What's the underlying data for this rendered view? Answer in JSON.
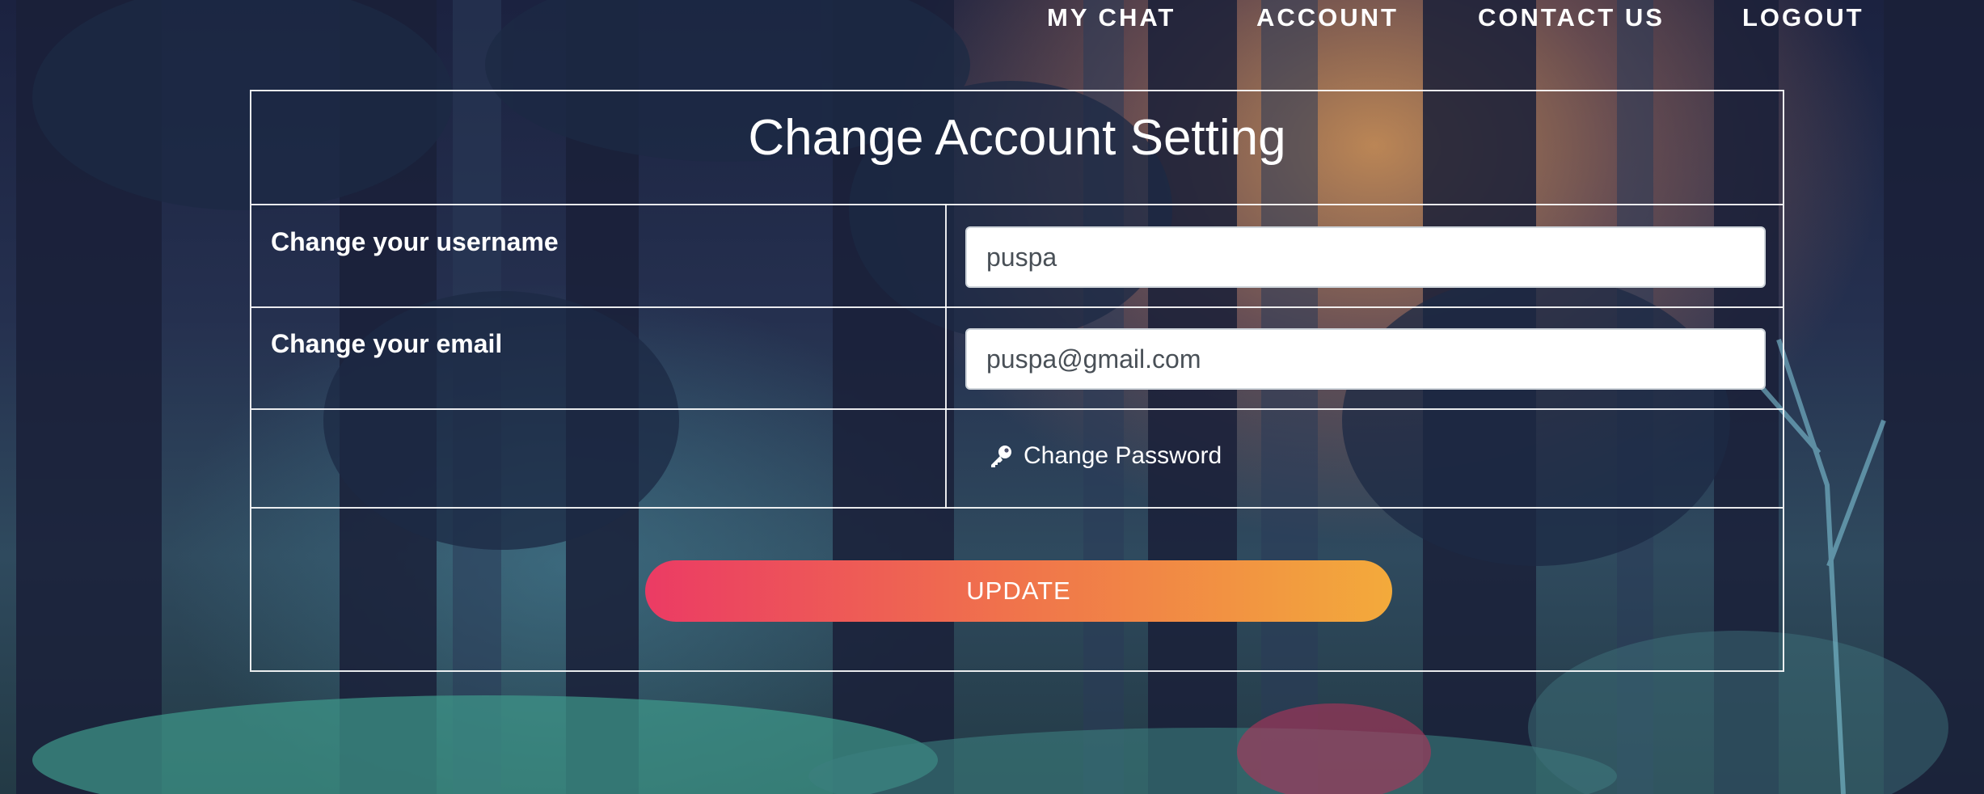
{
  "nav": {
    "items": [
      {
        "label": "MY CHAT"
      },
      {
        "label": "ACCOUNT"
      },
      {
        "label": "CONTACT US"
      },
      {
        "label": "LOGOUT"
      }
    ]
  },
  "form": {
    "title": "Change Account Setting",
    "username": {
      "label": "Change your username",
      "value": "puspa"
    },
    "email": {
      "label": "Change your email",
      "value": "puspa@gmail.com"
    },
    "change_password": {
      "label": "Change Password",
      "icon": "key-icon"
    },
    "update_button": "UPDATE"
  },
  "colors": {
    "button_gradient_start": "#eb3b64",
    "button_gradient_end": "#f3aa3b",
    "text": "#ffffff"
  }
}
